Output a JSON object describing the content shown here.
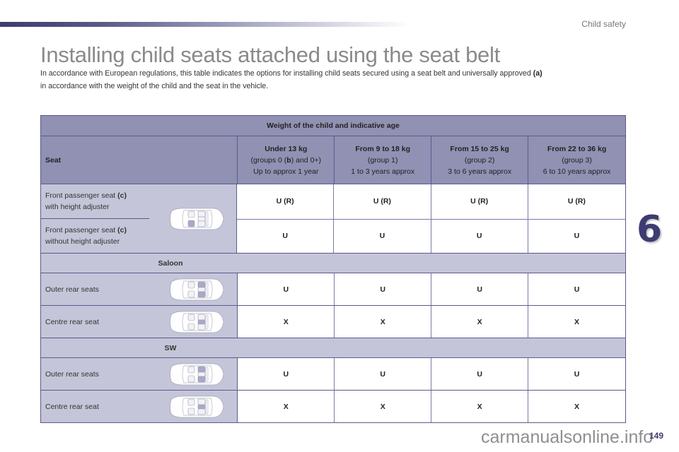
{
  "header": {
    "section": "Child safety",
    "title": "Installing child seats attached using the seat belt",
    "intro_line1": "In accordance with European regulations, this table indicates the options for installing child seats secured using a seat belt and universally approved",
    "intro_note": "(a)",
    "intro_line2": "in accordance with the weight of the child and the seat in the vehicle."
  },
  "table": {
    "top_header": "Weight of the child and indicative age",
    "seat_header": "Seat",
    "columns": [
      {
        "weight": "Under 13 kg",
        "group_prefix": "(groups 0 (",
        "group_note": "b",
        "group_suffix": ") and 0+)",
        "age": "Up to approx 1 year"
      },
      {
        "weight": "From 9 to 18 kg",
        "group": "(group 1)",
        "age": "1 to 3 years approx"
      },
      {
        "weight": "From 15 to 25 kg",
        "group": "(group 2)",
        "age": "3 to 6 years approx"
      },
      {
        "weight": "From 22 to 36 kg",
        "group": "(group 3)",
        "age": "6 to 10 years approx"
      }
    ],
    "front": {
      "rows": [
        {
          "label_line1": "Front passenger seat",
          "note": "(c)",
          "label_line2": "with height adjuster",
          "values": [
            "U (R)",
            "U (R)",
            "U (R)",
            "U (R)"
          ]
        },
        {
          "label_line1": "Front passenger seat",
          "note": "(c)",
          "label_line2": "without height adjuster",
          "values": [
            "U",
            "U",
            "U",
            "U"
          ]
        }
      ],
      "icon": "car-front-passenger-seat-icon"
    },
    "groups": [
      {
        "name": "Saloon",
        "rows": [
          {
            "label": "Outer rear seats",
            "icon": "car-outer-rear-seats-icon",
            "values": [
              "U",
              "U",
              "U",
              "U"
            ]
          },
          {
            "label": "Centre rear seat",
            "icon": "car-centre-rear-seat-icon",
            "values": [
              "X",
              "X",
              "X",
              "X"
            ]
          }
        ]
      },
      {
        "name": "SW",
        "rows": [
          {
            "label": "Outer rear seats",
            "icon": "car-outer-rear-seats-icon",
            "values": [
              "U",
              "U",
              "U",
              "U"
            ]
          },
          {
            "label": "Centre rear seat",
            "icon": "car-centre-rear-seat-icon",
            "values": [
              "X",
              "X",
              "X",
              "X"
            ]
          }
        ]
      }
    ]
  },
  "chapter_number": "6",
  "page_number": "149",
  "watermark": "carmanualsonline.info",
  "colors": {
    "header_bg": "#9091b3",
    "label_bg": "#c5c5d9",
    "border": "#5a5a8c",
    "accent": "#3c3c72"
  }
}
